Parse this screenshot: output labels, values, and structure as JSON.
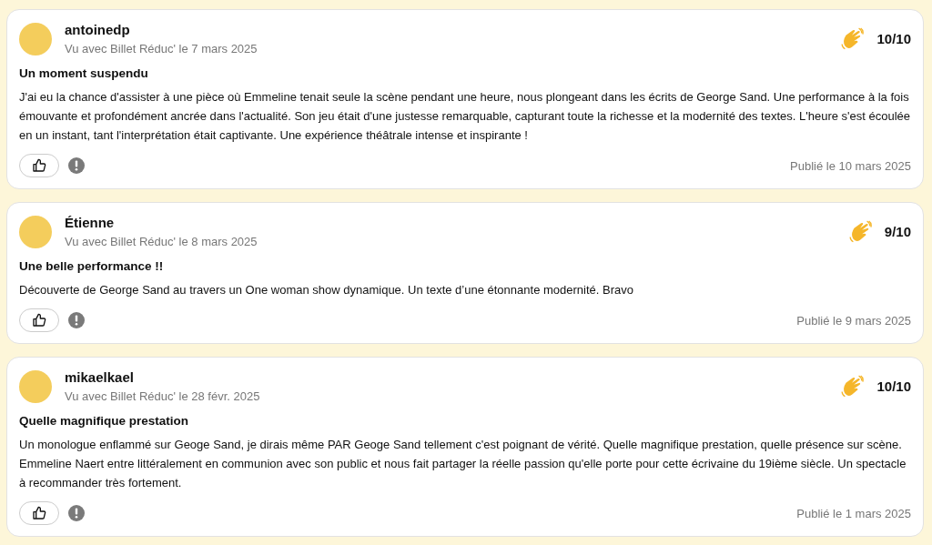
{
  "reviews": [
    {
      "author": "antoinedp",
      "seen": "Vu avec Billet Réduc' le 7 mars 2025",
      "rating": "10/10",
      "title": "Un moment suspendu",
      "body": "J'ai eu la chance d'assister à une pièce où Emmeline tenait seule la scène pendant une heure, nous plongeant dans les écrits de George Sand. Une performance à la fois émouvante et profondément ancrée dans l'actualité. Son jeu était d'une justesse remarquable, capturant toute la richesse et la modernité des textes. L'heure s'est écoulée en un instant, tant l'interprétation était captivante. Une expérience théâtrale intense et inspirante !",
      "published": "Publié le 10 mars 2025"
    },
    {
      "author": "Étienne",
      "seen": "Vu avec Billet Réduc' le 8 mars 2025",
      "rating": "9/10",
      "title": "Une belle performance !!",
      "body": "Découverte de George Sand au travers un One woman show dynamique. Un texte d’une étonnante modernité. Bravo",
      "published": "Publié le 9 mars 2025"
    },
    {
      "author": "mikaelkael",
      "seen": "Vu avec Billet Réduc' le 28 févr. 2025",
      "rating": "10/10",
      "title": "Quelle magnifique prestation",
      "body": "Un monologue enflammé sur Geoge Sand, je dirais même PAR Geoge Sand tellement c'est poignant de vérité. Quelle magnifique prestation, quelle présence sur scène. Emmeline Naert entre littéralement en communion avec son public et nous fait partager la réelle passion qu'elle porte pour cette écrivaine du 19ième siècle. Un spectacle à recommander très fortement.",
      "published": "Publié le 1 mars 2025"
    }
  ]
}
